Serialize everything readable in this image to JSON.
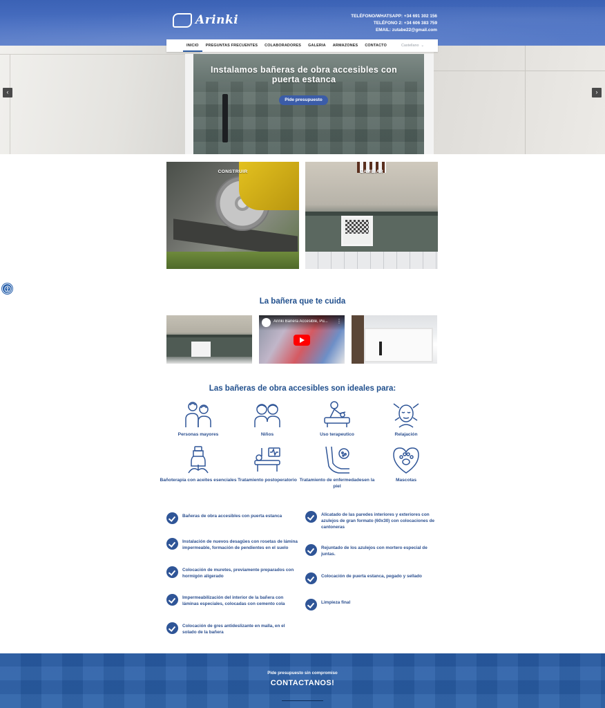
{
  "header": {
    "logo_text": "Arinki",
    "contact_lines": [
      "TELÉFONO/WHATSAPP: +34 691 302 156",
      "TELÉFONO 2: +34 606 383 759",
      "EMAIL: zutabe22@gmail.com"
    ]
  },
  "nav": {
    "items": [
      "INICIO",
      "PREGUNTAS FRECUENTES",
      "COLABORADORES",
      "GALERIA",
      "ARMAZONES",
      "CONTACTO"
    ],
    "language": "Castellano"
  },
  "hero": {
    "title_line1": "Instalamos bañeras de obra accesibles con",
    "title_line2": "puerta estanca",
    "button": "Pide presupuesto"
  },
  "services": [
    "CONSTRUIR",
    "CAMBIAR"
  ],
  "videos": {
    "title": "La bañera que te cuida",
    "video_title": "Arinki Bañera Accesible, Pu..."
  },
  "ideal": {
    "title": "Las bañeras de obra accesibles son ideales para:",
    "items": [
      {
        "label": "Personas mayores",
        "icon": "elderly-couple-icon"
      },
      {
        "label": "Niños",
        "icon": "children-icon"
      },
      {
        "label": "Uso terapeutico",
        "icon": "therapy-icon"
      },
      {
        "label": "Relajación",
        "icon": "relaxation-icon"
      },
      {
        "label": "Bañoterapia con aceites esenciales",
        "icon": "essential-oil-icon"
      },
      {
        "label": "Tratamiento postoperatorio",
        "icon": "postoperative-icon"
      },
      {
        "label": "Tratamiento de enfermedadesen la piel",
        "icon": "skin-treatment-icon"
      },
      {
        "label": "Mascotas",
        "icon": "pet-paw-icon"
      }
    ]
  },
  "checklist": {
    "left": [
      "Bañeras de obra accesibles con puerta estanca",
      "Instalación de nuevos desagües con rosetas de lámina impermeable, formación de pendientes en el suelo",
      "Colocación de muretes, previamente preparados con hormigón aligerado",
      "Impermeabilización del interior de la bañera con láminas especiales, colocadas con cemento cola",
      "Colocación de gres antideslizante en malla, en el solado de la bañera"
    ],
    "right": [
      "Alicatado de las paredes interiores y exteriores con azulejos de gran formato (60x30) con colocaciones de cantoneras",
      "Rejuntado de los azulejos con mortero especial de juntas.",
      "Colocación de puerta estanca, pegado y sellado",
      "Limpieza final"
    ]
  },
  "cta": {
    "small": "Pide presupuesto sin compromiso",
    "big": "CONTACTANOS!"
  },
  "colors": {
    "brand_blue": "#2f5597",
    "header_blue": "#4a70c2",
    "cta_blue": "#2a5ea8",
    "title_blue": "#1f4e8c"
  }
}
